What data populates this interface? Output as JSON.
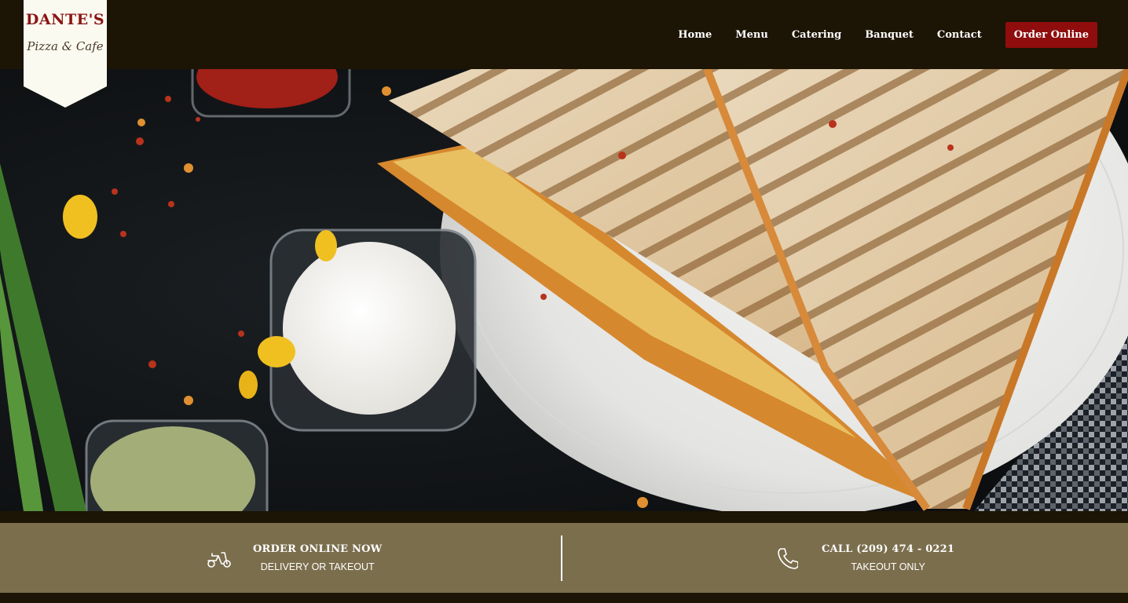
{
  "brand": {
    "name": "DANTE'S",
    "tagline": "Pizza & Cafe",
    "logo_color": "#8c1414"
  },
  "nav": {
    "items": [
      {
        "label": "Home"
      },
      {
        "label": "Menu"
      },
      {
        "label": "Catering"
      },
      {
        "label": "Banquet"
      },
      {
        "label": "Contact"
      }
    ],
    "order_button": "Order Online",
    "order_button_color": "#8f0d0d"
  },
  "hero": {
    "image": "grilled-sandwich-with-dips"
  },
  "info_bar": {
    "background_color": "#7b6e4d",
    "order": {
      "icon": "scooter-icon",
      "title": "ORDER ONLINE NOW",
      "subtitle": "DELIVERY OR TAKEOUT"
    },
    "call": {
      "icon": "phone-icon",
      "title": "CALL (209) 474 - 0221",
      "subtitle": "TAKEOUT ONLY"
    }
  }
}
